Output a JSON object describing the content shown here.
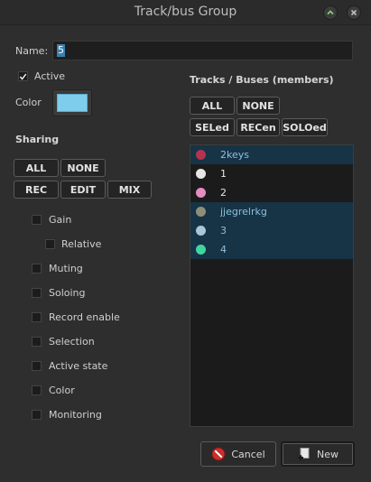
{
  "window": {
    "title": "Track/bus Group",
    "minimize_icon": "chevron-up-icon",
    "close_icon": "close-icon"
  },
  "name_field": {
    "label": "Name:",
    "value": "5"
  },
  "active": {
    "label": "Active",
    "checked": true
  },
  "color": {
    "label": "Color",
    "value": "#7ecdec"
  },
  "sharing": {
    "title": "Sharing",
    "quick_buttons": [
      "ALL",
      "NONE"
    ],
    "mode_buttons": [
      "REC",
      "EDIT",
      "MIX"
    ],
    "options": [
      {
        "label": "Gain",
        "checked": false
      },
      {
        "label": "Relative",
        "checked": false,
        "indent": true
      },
      {
        "label": "Muting",
        "checked": false
      },
      {
        "label": "Soloing",
        "checked": false
      },
      {
        "label": "Record enable",
        "checked": false
      },
      {
        "label": "Selection",
        "checked": false
      },
      {
        "label": "Active state",
        "checked": false
      },
      {
        "label": "Color",
        "checked": false
      },
      {
        "label": "Monitoring",
        "checked": false
      }
    ]
  },
  "tracks": {
    "title": "Tracks / Buses (members)",
    "row1_buttons": [
      "ALL",
      "NONE"
    ],
    "row2_buttons": [
      "SELed",
      "RECen",
      "SOLOed"
    ],
    "items": [
      {
        "name": "2keys",
        "color": "#b5334f",
        "selected": true
      },
      {
        "name": "1",
        "color": "#e6e6e6",
        "selected": false
      },
      {
        "name": "2",
        "color": "#e58cc0",
        "selected": false
      },
      {
        "name": "jjegrelrkg",
        "color": "#8f8f78",
        "selected": true
      },
      {
        "name": "3",
        "color": "#a6c8d8",
        "selected": true
      },
      {
        "name": "4",
        "color": "#3fd6a0",
        "selected": true
      }
    ]
  },
  "footer": {
    "cancel_label": "Cancel",
    "cancel_icon": "no-entry-icon",
    "new_label": "New",
    "new_icon": "new-document-icon"
  }
}
